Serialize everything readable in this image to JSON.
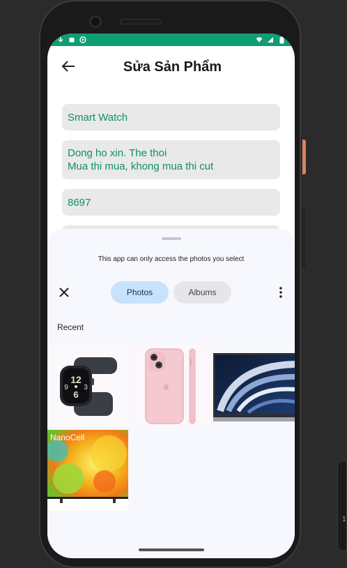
{
  "app": {
    "title": "Sửa Sản Phẩm"
  },
  "colors": {
    "status_bar": "#0f9d73",
    "field_text": "#0f8f66",
    "field_bg": "#e9e9e9",
    "tab_selected_bg": "#c7e3fb"
  },
  "status_bar": {
    "left_icons": [
      "download-icon",
      "box-icon",
      "shield-icon"
    ],
    "right_icons": [
      "wifi-icon",
      "signal-icon",
      "battery-icon"
    ]
  },
  "form": {
    "name_value": "Smart Watch",
    "description_line1": "Dong ho xin. The thoi",
    "description_line2": "Mua thi mua, khong mua thi cut",
    "price_value": "8697"
  },
  "photo_picker": {
    "notice": "This app can only access the photos you select",
    "tabs": [
      {
        "label": "Photos",
        "selected": true
      },
      {
        "label": "Albums",
        "selected": false
      }
    ],
    "section_label": "Recent",
    "thumbnails": [
      {
        "subject": "smart watch"
      },
      {
        "subject": "pink phone"
      },
      {
        "subject": "laptop"
      },
      {
        "subject": "television",
        "overlay_text": "NanoCell"
      }
    ]
  },
  "edge_widget": {
    "digit": "1"
  }
}
